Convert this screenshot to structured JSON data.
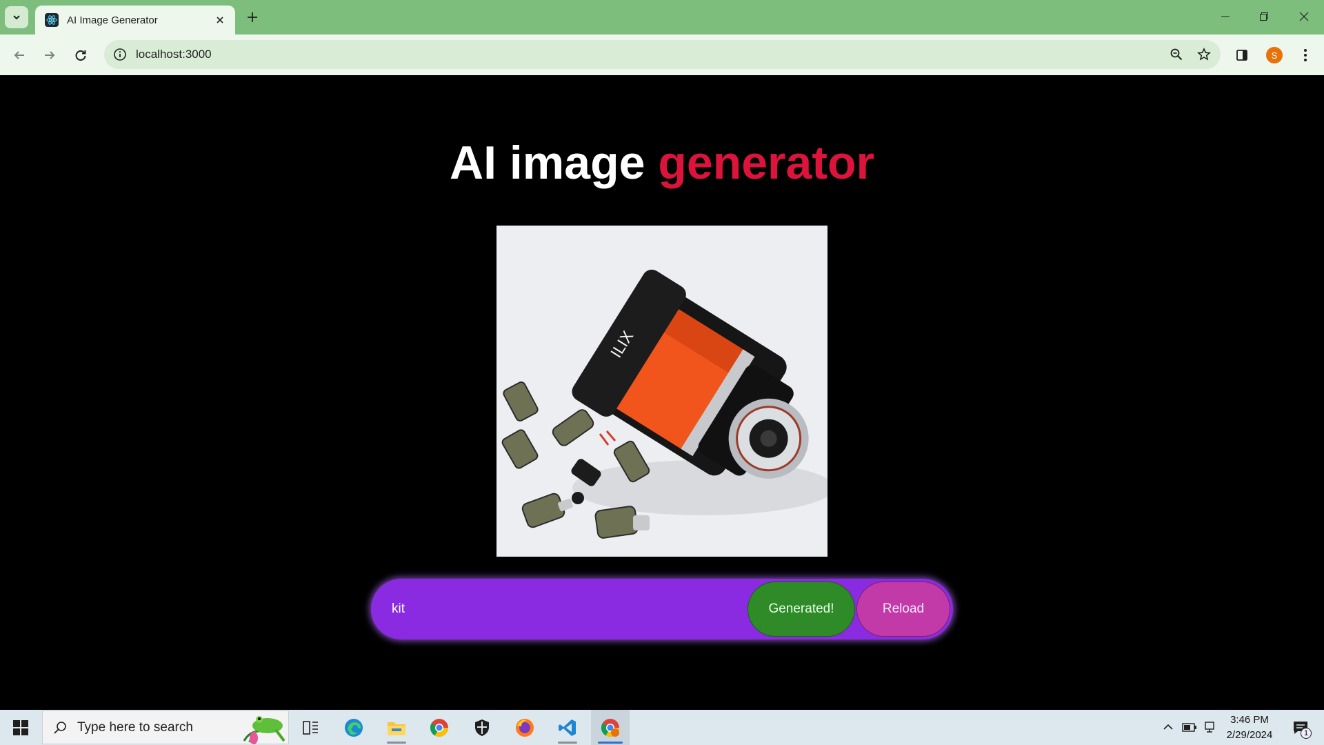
{
  "browser": {
    "tab": {
      "title": "AI Image Generator",
      "favicon": "react-icon"
    },
    "address_bar": {
      "url": "localhost:3000"
    },
    "profile_initial": "S",
    "colors": {
      "frame": "#7dbe7d",
      "toolbar": "#eef7ec",
      "omnibox": "#d9ecd6"
    }
  },
  "page": {
    "heading": {
      "prefix": "AI image",
      "accent": "generator"
    },
    "image": {
      "description_icon": "generated-image",
      "subject": "ai-generated-image"
    },
    "prompt": {
      "value": "kit",
      "placeholder": ""
    },
    "generate_button": "Generated!",
    "reload_button": "Reload",
    "colors": {
      "background": "#000000",
      "accent": "#dc143c",
      "prompt_bar": "#8a2be2",
      "generate": "#2e8b27",
      "reload": "#c23aa8"
    }
  },
  "taskbar": {
    "search_placeholder": "Type here to search",
    "apps": [
      "task-view-icon",
      "edge-icon",
      "file-explorer-icon",
      "chrome-icon",
      "security-icon",
      "firefox-icon",
      "vscode-icon",
      "chrome-active-icon"
    ],
    "clock": {
      "time": "3:46 PM",
      "date": "2/29/2024"
    },
    "notification_count": "1"
  }
}
